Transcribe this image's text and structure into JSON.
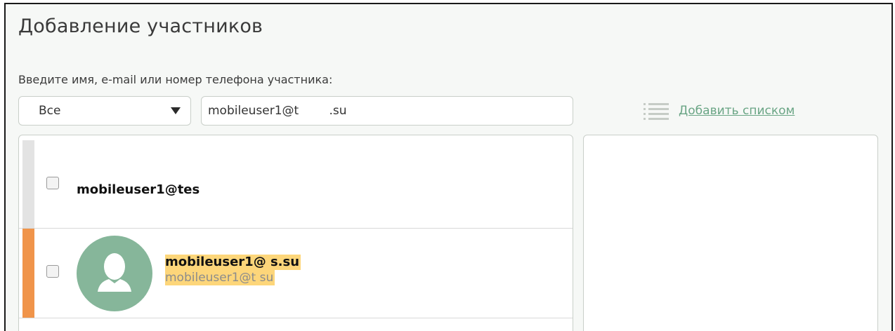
{
  "dialog": {
    "title": "Добавление участников",
    "hint": "Введите имя, e-mail или номер телефона участника:"
  },
  "filter": {
    "selected": "Все"
  },
  "search": {
    "value": "mobileuser1@t        .su"
  },
  "add_list": {
    "label": "Добавить списком",
    "icon": "list-icon"
  },
  "results": [
    {
      "email": "mobileuser1@tes",
      "has_avatar": false,
      "highlighted": false
    },
    {
      "name": "mobileuser1@         s.su",
      "email": "mobileuser1@t         su",
      "has_avatar": true,
      "highlighted": true
    }
  ],
  "colors": {
    "accent": "#6aa585",
    "active_stripe": "#f0944a",
    "inactive_stripe": "#e3e3e3",
    "avatar_bg": "#86b69a",
    "highlight": "#fdd67a"
  }
}
